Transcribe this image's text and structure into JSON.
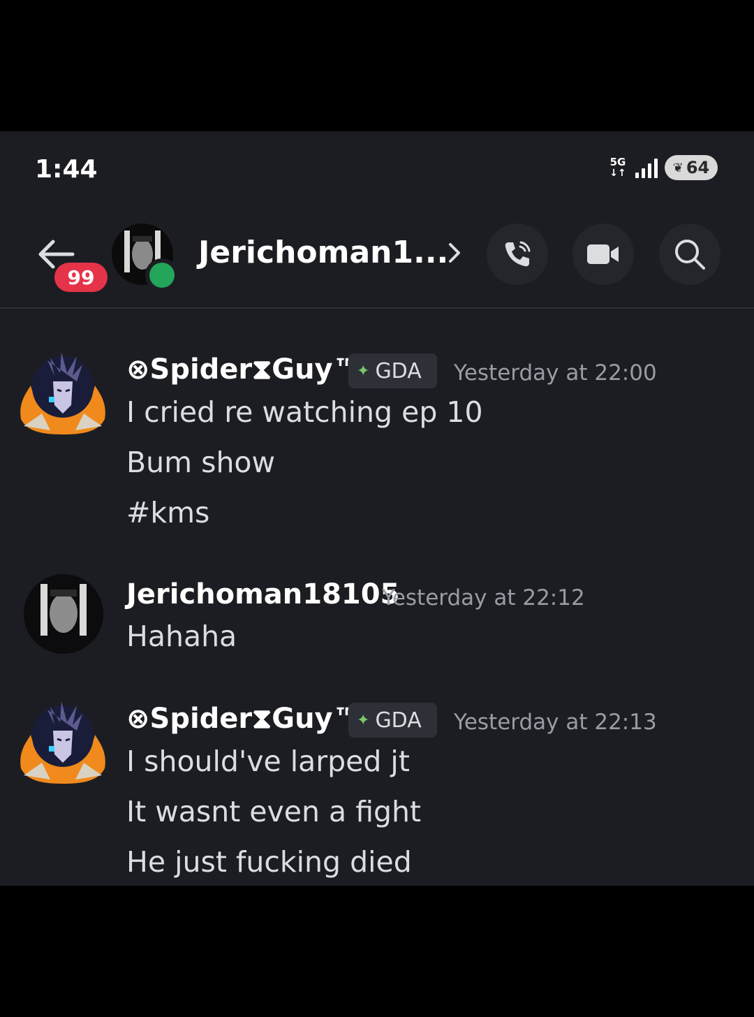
{
  "status_bar": {
    "time": "1:44",
    "network": "5G",
    "battery": "64"
  },
  "header": {
    "back_label": "Back",
    "unread_count": "99",
    "title": "Jerichoman1...",
    "call_label": "Voice call",
    "video_label": "Video call",
    "search_label": "Search"
  },
  "messages": [
    {
      "author": "⊗Spider⧗Guy™",
      "tag": "GDA",
      "timestamp": "Yesterday at 22:00",
      "lines": [
        "I cried re watching ep 10",
        "Bum show",
        "#kms"
      ]
    },
    {
      "author": "Jerichoman18105",
      "timestamp": "Yesterday at 22:12",
      "lines": [
        "Hahaha"
      ]
    },
    {
      "author": "⊗Spider⧗Guy™",
      "tag": "GDA",
      "timestamp": "Yesterday at 22:13",
      "lines": [
        "I should've larped jt",
        "It wasnt even a fight",
        "He just fucking died"
      ]
    }
  ],
  "colors": {
    "background": "#1c1d22",
    "badge": "#e5334a",
    "online": "#23a55a",
    "timestamp": "#9a9ca4"
  }
}
